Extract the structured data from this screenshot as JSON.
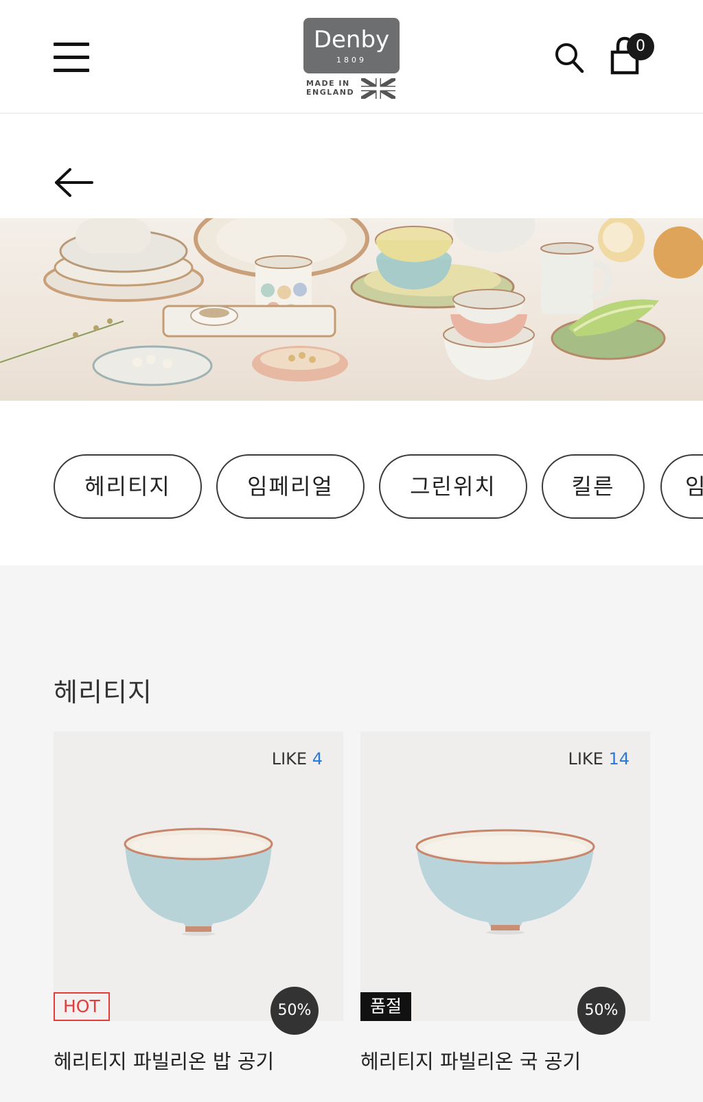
{
  "header": {
    "menu_icon": "hamburger-menu-icon",
    "logo": {
      "word": "Denby",
      "year": "1809",
      "made_line1": "MADE IN",
      "made_line2": "ENGLAND"
    },
    "search_icon": "search-icon",
    "bag_icon": "shopping-bag-icon",
    "bag_count": "0"
  },
  "nav": {
    "back_icon": "arrow-left-icon"
  },
  "categories": [
    {
      "label": "헤리티지"
    },
    {
      "label": "임페리얼"
    },
    {
      "label": "그린위치"
    },
    {
      "label": "킬른"
    },
    {
      "label": "임"
    }
  ],
  "section": {
    "title": "헤리티지",
    "products": [
      {
        "like_label": "LIKE",
        "like_count": "4",
        "badge": "HOT",
        "discount": "50%",
        "name": "헤리티지 파빌리온 밥 공기"
      },
      {
        "like_label": "LIKE",
        "like_count": "14",
        "badge": "품절",
        "discount": "50%",
        "name": "헤리티지 파빌리온 국 공기"
      }
    ]
  },
  "colors": {
    "accent_like": "#2a7bd9",
    "hot_red": "#e43b3b",
    "logo_gray": "#6d6e70"
  }
}
